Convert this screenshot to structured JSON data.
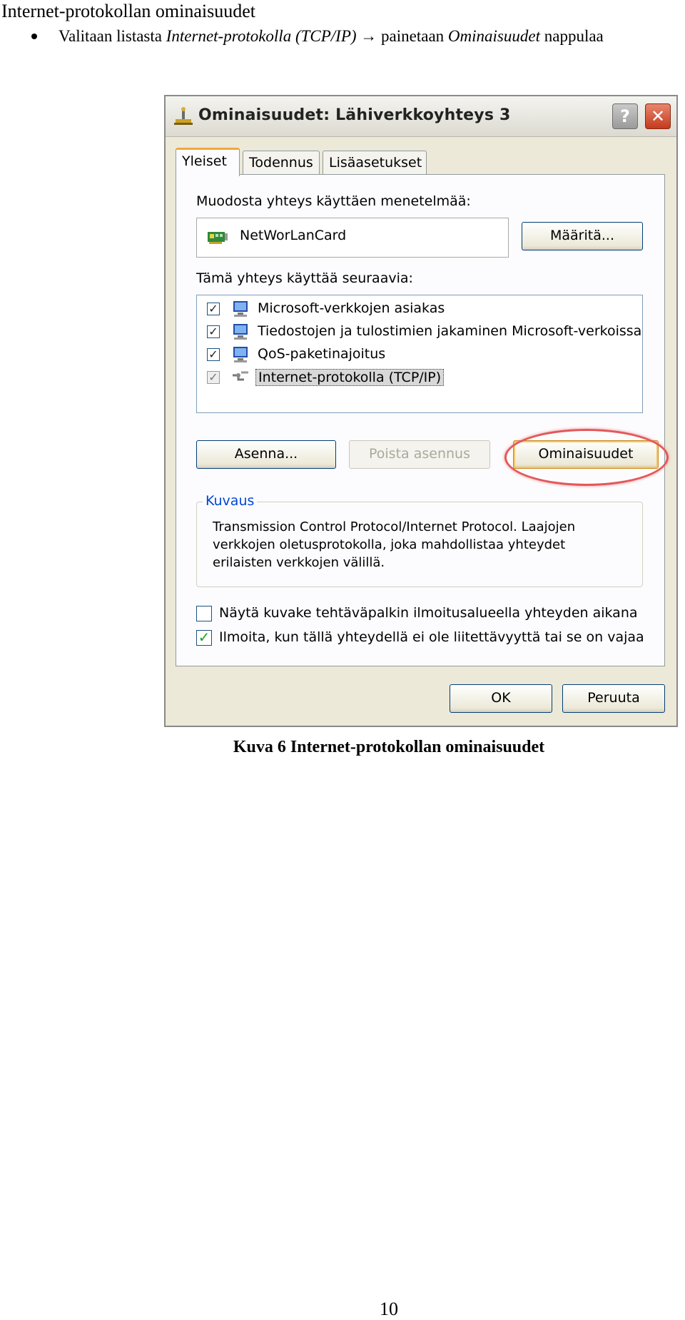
{
  "document": {
    "heading": "Internet-protokollan ominaisuudet",
    "instruction": {
      "part1": "Valitaan listasta ",
      "italic1": "Internet-protokolla (TCP/IP)",
      "arrow": "→",
      "part2": " painetaan ",
      "italic2": "Ominaisuudet",
      "part3": " nappulaa"
    },
    "caption": "Kuva 6 Internet-protokollan ominaisuudet",
    "page_number": "10"
  },
  "dialog": {
    "title": "Ominaisuudet: Lähiverkkoyhteys 3",
    "help_label": "?",
    "close_label": "✕",
    "tabs": [
      {
        "label": "Yleiset",
        "active": true
      },
      {
        "label": "Todennus",
        "active": false
      },
      {
        "label": "Lisäasetukset",
        "active": false
      }
    ],
    "connect_using_label": "Muodosta yhteys käyttäen menetelmää:",
    "adapter_name": "NetWorLanCard",
    "configure_button": "Määritä...",
    "components_label": "Tämä yhteys käyttää seuraavia:",
    "components": [
      {
        "label": "Microsoft-verkkojen asiakas",
        "checked": true,
        "selected": false
      },
      {
        "label": "Tiedostojen ja tulostimien jakaminen Microsoft-verkoissa",
        "checked": true,
        "selected": false
      },
      {
        "label": "QoS-paketinajoitus",
        "checked": true,
        "selected": false
      },
      {
        "label": "Internet-protokolla (TCP/IP)",
        "checked": true,
        "selected": true
      }
    ],
    "install_button": "Asenna...",
    "uninstall_button": "Poista asennus",
    "properties_button": "Ominaisuudet",
    "description_legend": "Kuvaus",
    "description_text": "Transmission Control Protocol/Internet Protocol. Laajojen verkkojen oletusprotokolla, joka mahdollistaa yhteydet erilaisten verkkojen välillä.",
    "option_show_icon": {
      "label": "Näytä kuvake tehtäväpalkin ilmoitusalueella yhteyden aikana",
      "checked": false
    },
    "option_notify": {
      "label": "Ilmoita, kun tällä yhteydellä ei ole liitettävyyttä tai se on vajaa",
      "checked": true
    },
    "ok_button": "OK",
    "cancel_button": "Peruuta",
    "check_mark": "✓",
    "highlight_color": "#e2585a"
  }
}
